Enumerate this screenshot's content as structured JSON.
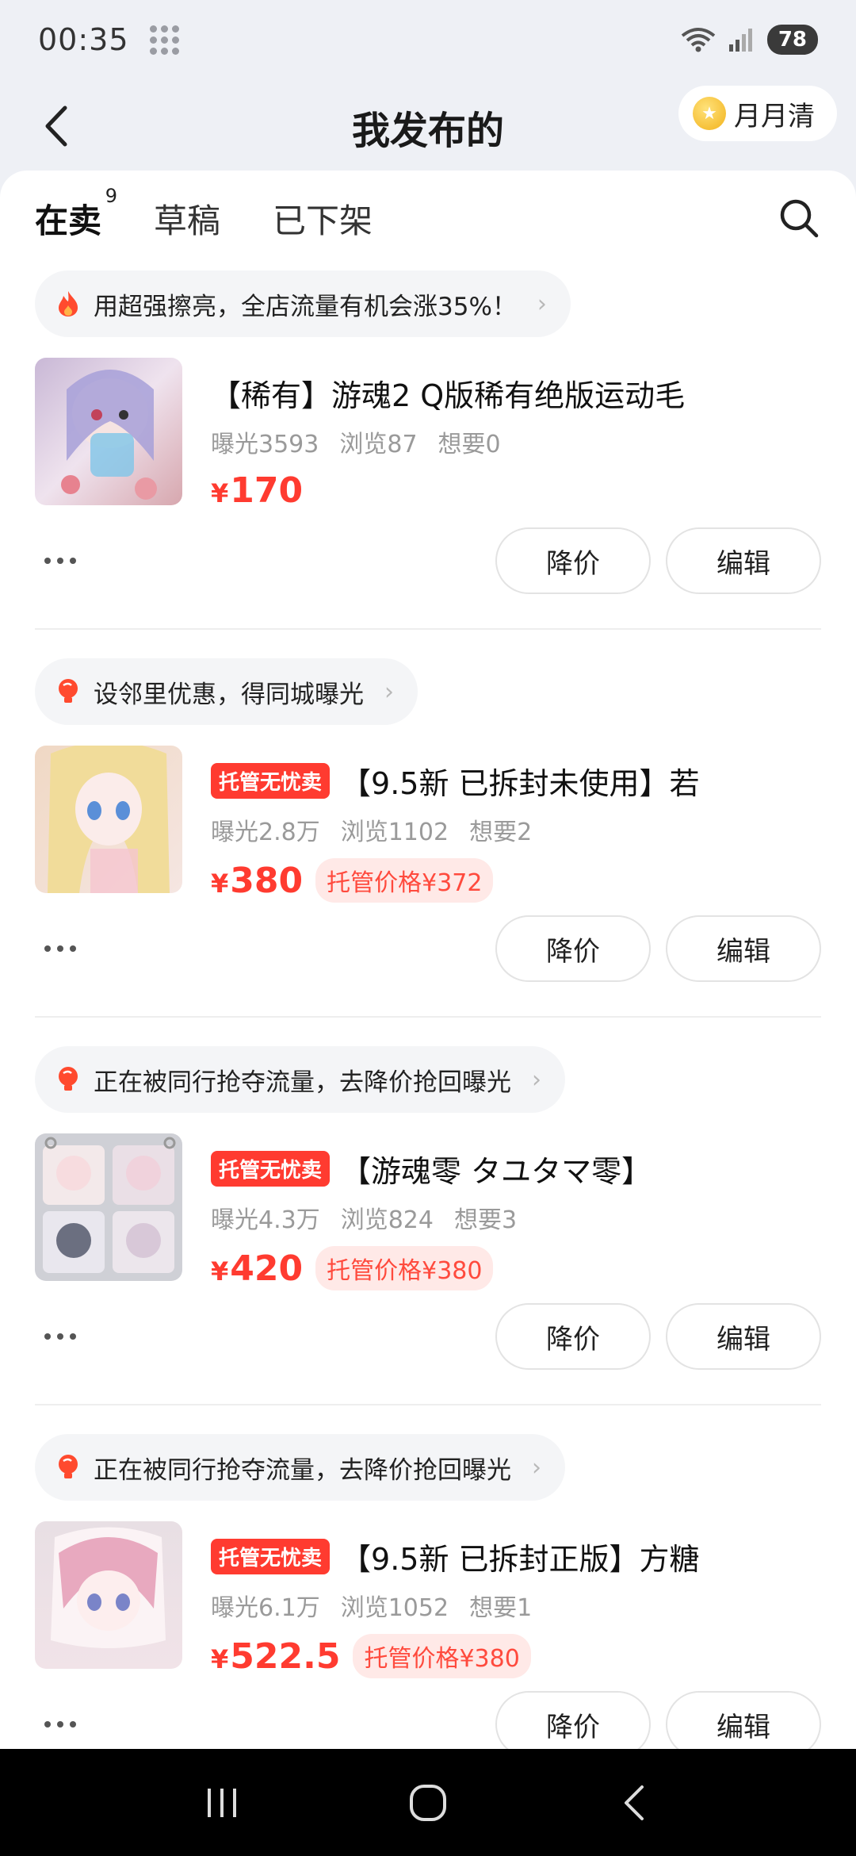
{
  "status_bar": {
    "time": "00:35",
    "battery": "78"
  },
  "header": {
    "title": "我发布的",
    "monthly_label": "月月清"
  },
  "tabs": [
    {
      "label": "在卖",
      "count": "9",
      "active": true
    },
    {
      "label": "草稿"
    },
    {
      "label": "已下架"
    }
  ],
  "listings": [
    {
      "tip": "用超强擦亮，全店流量有机会涨35%！",
      "tip_icon": "fire-icon",
      "badge": "",
      "title": "【稀有】游魂2 Q版稀有绝版运动毛",
      "exposure": "曝光3593",
      "views": "浏览87",
      "wants": "想要0",
      "currency": "¥",
      "price": "170",
      "managed_price": "",
      "price_down_label": "降价",
      "edit_label": "编辑"
    },
    {
      "tip": "设邻里优惠，得同城曝光",
      "tip_icon": "lightbulb-icon",
      "badge": "托管无忧卖",
      "title": "【9.5新 已拆封未使用】若",
      "exposure": "曝光2.8万",
      "views": "浏览1102",
      "wants": "想要2",
      "currency": "¥",
      "price": "380",
      "managed_price": "托管价格¥372",
      "price_down_label": "降价",
      "edit_label": "编辑"
    },
    {
      "tip": "正在被同行抢夺流量，去降价抢回曝光",
      "tip_icon": "lightbulb-icon",
      "badge": "托管无忧卖",
      "title": "【游魂零 タユタマ零】",
      "exposure": "曝光4.3万",
      "views": "浏览824",
      "wants": "想要3",
      "currency": "¥",
      "price": "420",
      "managed_price": "托管价格¥380",
      "price_down_label": "降价",
      "edit_label": "编辑"
    },
    {
      "tip": "正在被同行抢夺流量，去降价抢回曝光",
      "tip_icon": "lightbulb-icon",
      "badge": "托管无忧卖",
      "title": "【9.5新 已拆封正版】方糖",
      "exposure": "曝光6.1万",
      "views": "浏览1052",
      "wants": "想要1",
      "currency": "¥",
      "price": "522.5",
      "managed_price": "托管价格¥380",
      "price_down_label": "降价",
      "edit_label": "编辑"
    }
  ],
  "colors": {
    "accent_red": "#ff3b30",
    "tab_highlight": "#ffe100"
  }
}
